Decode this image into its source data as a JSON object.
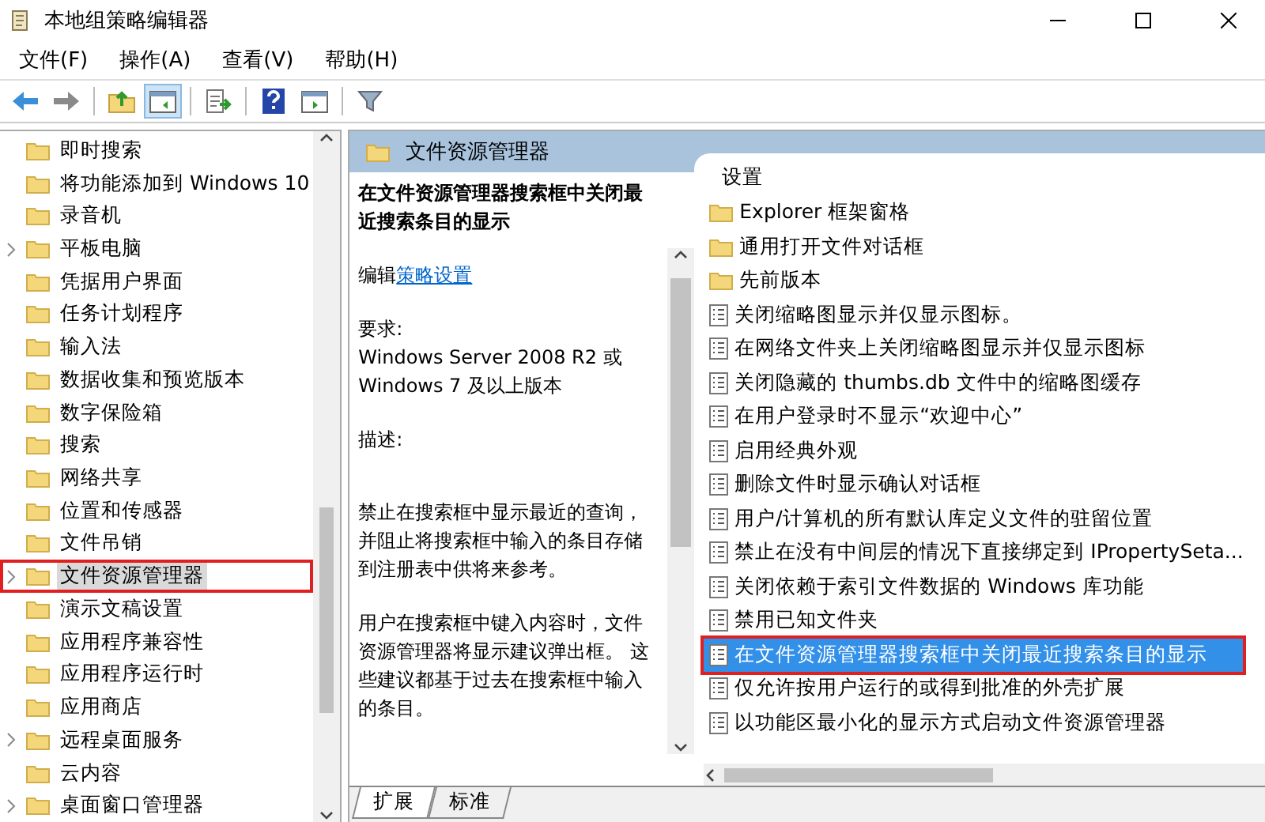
{
  "window": {
    "title": "本地组策略编辑器"
  },
  "menu": [
    "文件(F)",
    "操作(A)",
    "查看(V)",
    "帮助(H)"
  ],
  "toolbar": [
    [
      {
        "kind": "back",
        "pressed": false
      },
      {
        "kind": "forward",
        "pressed": false
      }
    ],
    [
      {
        "kind": "up",
        "pressed": false
      },
      {
        "kind": "tree",
        "pressed": true
      }
    ],
    [
      {
        "kind": "export",
        "pressed": false
      }
    ],
    [
      {
        "kind": "help",
        "pressed": false
      },
      {
        "kind": "pane",
        "pressed": false
      }
    ],
    [
      {
        "kind": "filter",
        "pressed": false
      }
    ]
  ],
  "tree": [
    {
      "label": "即时搜索",
      "expandable": false,
      "selected": false,
      "marked": false
    },
    {
      "label": "将功能添加到 Windows 10",
      "expandable": false,
      "selected": false,
      "marked": false
    },
    {
      "label": "录音机",
      "expandable": false,
      "selected": false,
      "marked": false
    },
    {
      "label": "平板电脑",
      "expandable": true,
      "selected": false,
      "marked": false
    },
    {
      "label": "凭据用户界面",
      "expandable": false,
      "selected": false,
      "marked": false
    },
    {
      "label": "任务计划程序",
      "expandable": false,
      "selected": false,
      "marked": false
    },
    {
      "label": "输入法",
      "expandable": false,
      "selected": false,
      "marked": false
    },
    {
      "label": "数据收集和预览版本",
      "expandable": false,
      "selected": false,
      "marked": false
    },
    {
      "label": "数字保险箱",
      "expandable": false,
      "selected": false,
      "marked": false
    },
    {
      "label": "搜索",
      "expandable": false,
      "selected": false,
      "marked": false
    },
    {
      "label": "网络共享",
      "expandable": false,
      "selected": false,
      "marked": false
    },
    {
      "label": "位置和传感器",
      "expandable": false,
      "selected": false,
      "marked": false
    },
    {
      "label": "文件吊销",
      "expandable": false,
      "selected": false,
      "marked": false
    },
    {
      "label": "文件资源管理器",
      "expandable": true,
      "selected": true,
      "marked": true
    },
    {
      "label": "演示文稿设置",
      "expandable": false,
      "selected": false,
      "marked": false
    },
    {
      "label": "应用程序兼容性",
      "expandable": false,
      "selected": false,
      "marked": false
    },
    {
      "label": "应用程序运行时",
      "expandable": false,
      "selected": false,
      "marked": false
    },
    {
      "label": "应用商店",
      "expandable": false,
      "selected": false,
      "marked": false
    },
    {
      "label": "远程桌面服务",
      "expandable": true,
      "selected": false,
      "marked": false
    },
    {
      "label": "云内容",
      "expandable": false,
      "selected": false,
      "marked": false
    },
    {
      "label": "桌面窗口管理器",
      "expandable": true,
      "selected": false,
      "marked": false
    }
  ],
  "details": {
    "header": "文件资源管理器",
    "title": "在文件资源管理器搜索框中关闭最近搜索条目的显示",
    "edit_prefix": "编辑",
    "edit_link": "策略设置",
    "requirements_label": "要求:",
    "requirements": "Windows Server 2008 R2 或 Windows 7 及以上版本",
    "description_label": "描述:",
    "paragraphs": [
      "禁止在搜索框中显示最近的查询，并阻止将搜索框中输入的条目存储到注册表中供将来参考。",
      "用户在搜索框中键入内容时，文件资源管理器将显示建议弹出框。 这些建议都基于过去在搜索框中输入的条目。"
    ]
  },
  "settings": {
    "heading": "设置",
    "items": [
      {
        "kind": "folder",
        "label": "Explorer 框架窗格",
        "selected": false,
        "marked": false
      },
      {
        "kind": "folder",
        "label": "通用打开文件对话框",
        "selected": false,
        "marked": false
      },
      {
        "kind": "folder",
        "label": "先前版本",
        "selected": false,
        "marked": false
      },
      {
        "kind": "setting",
        "label": "关闭缩略图显示并仅显示图标。",
        "selected": false,
        "marked": false
      },
      {
        "kind": "setting",
        "label": "在网络文件夹上关闭缩略图显示并仅显示图标",
        "selected": false,
        "marked": false
      },
      {
        "kind": "setting",
        "label": "关闭隐藏的 thumbs.db 文件中的缩略图缓存",
        "selected": false,
        "marked": false
      },
      {
        "kind": "setting",
        "label": "在用户登录时不显示“欢迎中心”",
        "selected": false,
        "marked": false
      },
      {
        "kind": "setting",
        "label": "启用经典外观",
        "selected": false,
        "marked": false
      },
      {
        "kind": "setting",
        "label": "删除文件时显示确认对话框",
        "selected": false,
        "marked": false
      },
      {
        "kind": "setting",
        "label": "用户/计算机的所有默认库定义文件的驻留位置",
        "selected": false,
        "marked": false
      },
      {
        "kind": "setting",
        "label": "禁止在没有中间层的情况下直接绑定到 IPropertySeta...",
        "selected": false,
        "marked": false
      },
      {
        "kind": "setting",
        "label": "关闭依赖于索引文件数据的 Windows 库功能",
        "selected": false,
        "marked": false
      },
      {
        "kind": "setting",
        "label": "禁用已知文件夹",
        "selected": false,
        "marked": false
      },
      {
        "kind": "setting",
        "label": "在文件资源管理器搜索框中关闭最近搜索条目的显示",
        "selected": true,
        "marked": true
      },
      {
        "kind": "setting",
        "label": "仅允许按用户运行的或得到批准的外壳扩展",
        "selected": false,
        "marked": false
      },
      {
        "kind": "setting",
        "label": "以功能区最小化的显示方式启动文件资源管理器",
        "selected": false,
        "marked": false
      }
    ]
  },
  "tabs": [
    {
      "label": "扩展",
      "selected": true
    },
    {
      "label": "标准",
      "selected": false
    }
  ]
}
